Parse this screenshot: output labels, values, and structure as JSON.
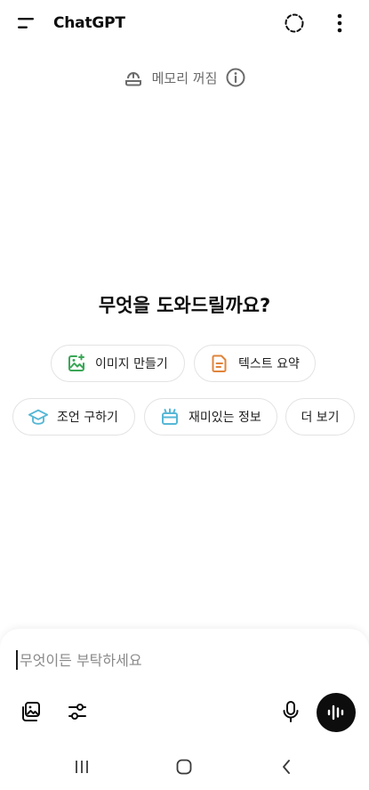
{
  "header": {
    "title": "ChatGPT",
    "menu_icon": "menu-icon",
    "temp_chat_icon": "temporary-chat-icon",
    "more_icon": "more-vertical-icon"
  },
  "memory": {
    "label": "메모리 꺼짐",
    "icon": "memory-icon",
    "info_icon": "info-icon"
  },
  "hero": {
    "title": "무엇을 도와드릴까요?"
  },
  "suggestions": [
    {
      "label": "이미지 만들기",
      "icon": "image-create-icon",
      "color": "#3aa757"
    },
    {
      "label": "텍스트 요약",
      "icon": "document-icon",
      "color": "#e0843a"
    },
    {
      "label": "조언 구하기",
      "icon": "graduation-cap-icon",
      "color": "#56b7d6"
    },
    {
      "label": "재미있는 정보",
      "icon": "gift-box-icon",
      "color": "#56b7d6"
    },
    {
      "label": "더 보기",
      "icon": "",
      "color": ""
    }
  ],
  "composer": {
    "placeholder": "무엇이든 부탁하세요",
    "value": ""
  },
  "colors": {
    "text": "#0d0d0d",
    "muted": "#6b6b6b",
    "chip_border": "#e3e3e3",
    "voice_button": "#0d0d0d"
  }
}
